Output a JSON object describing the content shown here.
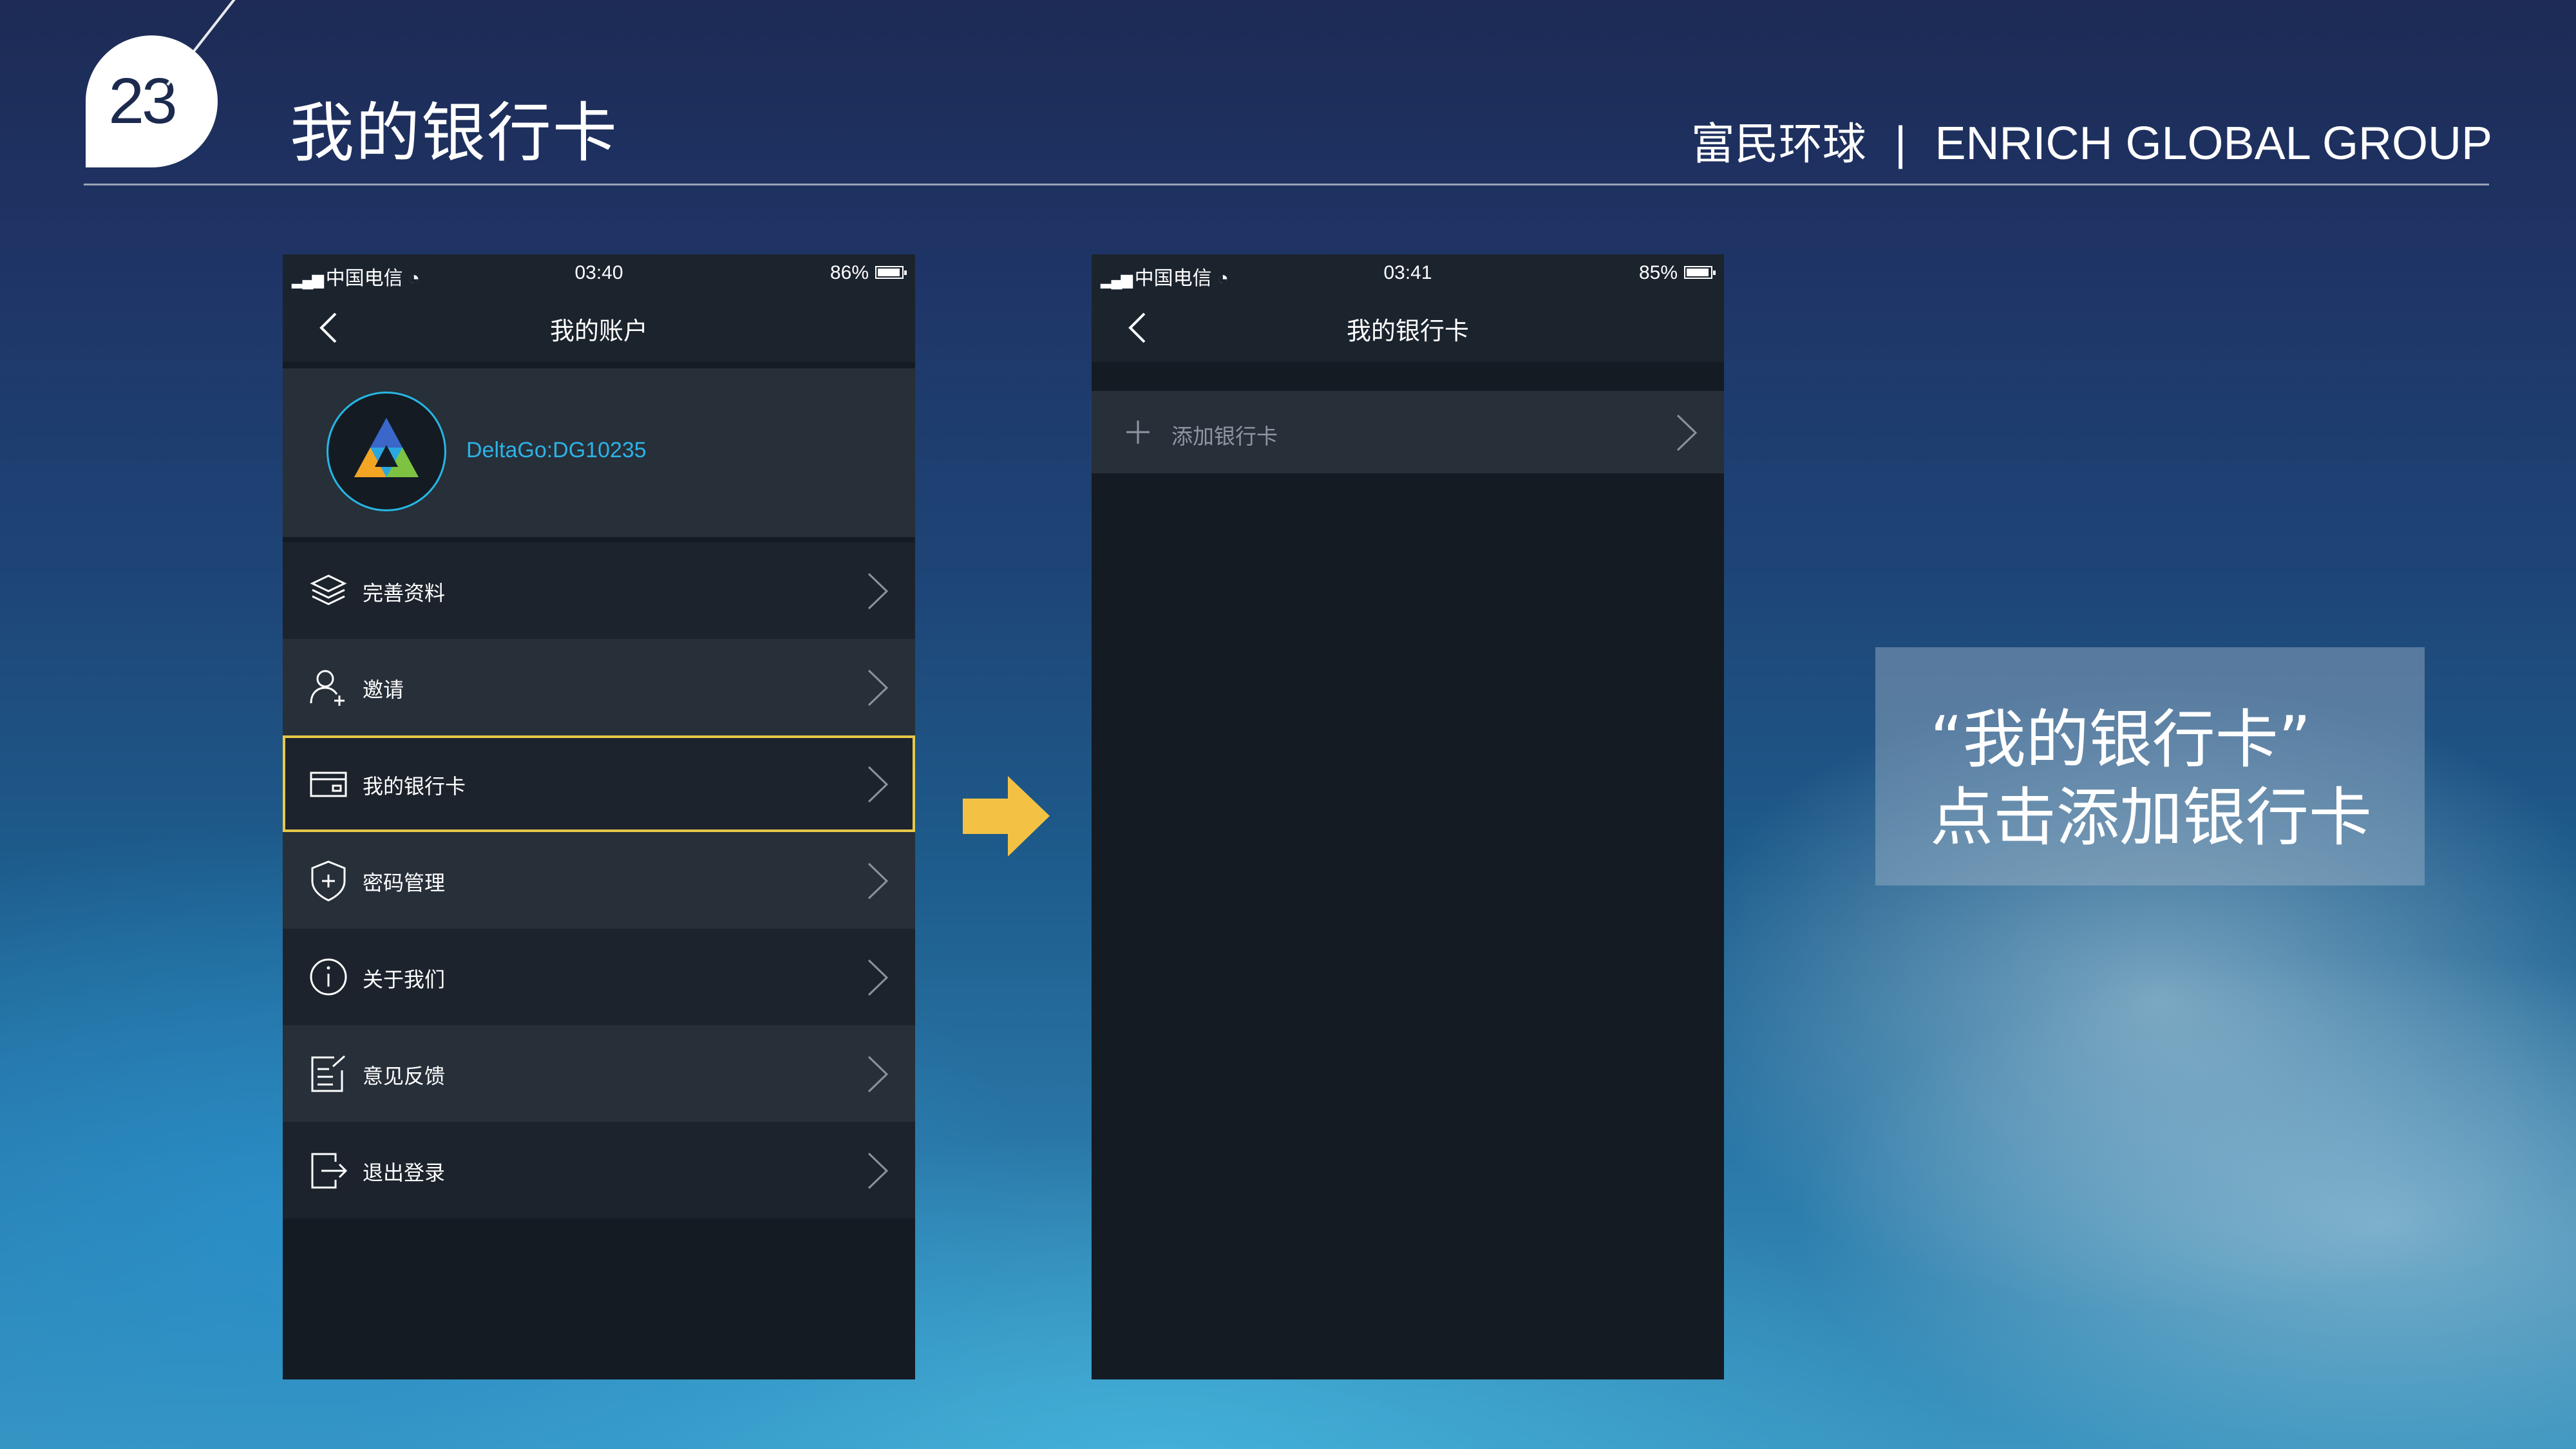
{
  "slide": {
    "page_number": "23",
    "title": "我的银行卡",
    "brand_cn": "富民环球",
    "brand_separator": "|",
    "brand_en": "ENRICH GLOBAL GROUP"
  },
  "left_phone": {
    "status": {
      "carrier": "中国电信",
      "time": "03:40",
      "battery": "86%"
    },
    "nav_title": "我的账户",
    "account_id": "DeltaGo:DG10235",
    "menu": [
      {
        "label": "完善资料",
        "icon": "layers-icon"
      },
      {
        "label": "邀请",
        "icon": "add-user-icon"
      },
      {
        "label": "我的银行卡",
        "icon": "bank-card-icon",
        "highlighted": true
      },
      {
        "label": "密码管理",
        "icon": "shield-plus-icon"
      },
      {
        "label": "关于我们",
        "icon": "info-icon"
      },
      {
        "label": "意见反馈",
        "icon": "feedback-edit-icon"
      },
      {
        "label": "退出登录",
        "icon": "logout-icon"
      }
    ],
    "highlight_color": "#e6c84a"
  },
  "right_phone": {
    "status": {
      "carrier": "中国电信",
      "time": "03:41",
      "battery": "85%"
    },
    "nav_title": "我的银行卡",
    "add_card_label": "添加银行卡"
  },
  "callout": {
    "line1": "“我的银行卡”",
    "line2": "点击添加银行卡"
  },
  "colors": {
    "accent_blue": "#2cb3e6",
    "arrow_yellow": "#f3c245"
  }
}
